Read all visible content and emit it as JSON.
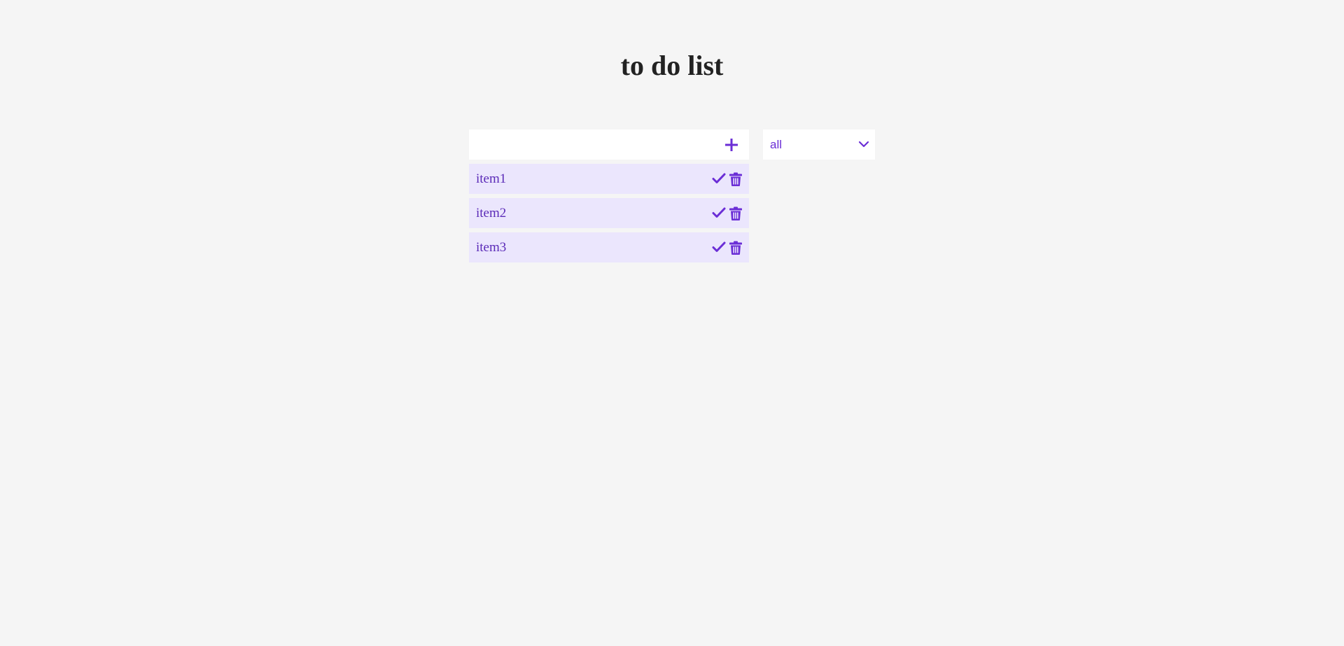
{
  "header": {
    "title": "to do list"
  },
  "form": {
    "input_value": "",
    "input_placeholder": "",
    "add_icon": "plus-icon"
  },
  "filter": {
    "selected": "all",
    "icon": "chevron-down-icon"
  },
  "todos": [
    {
      "label": "item1",
      "complete_icon": "check-icon",
      "delete_icon": "trash-icon"
    },
    {
      "label": "item2",
      "complete_icon": "check-icon",
      "delete_icon": "trash-icon"
    },
    {
      "label": "item3",
      "complete_icon": "check-icon",
      "delete_icon": "trash-icon"
    }
  ],
  "colors": {
    "background": "#f5f5f5",
    "accent": "#6b2ed6",
    "item_background": "#ebe6fd",
    "title": "#222222"
  }
}
